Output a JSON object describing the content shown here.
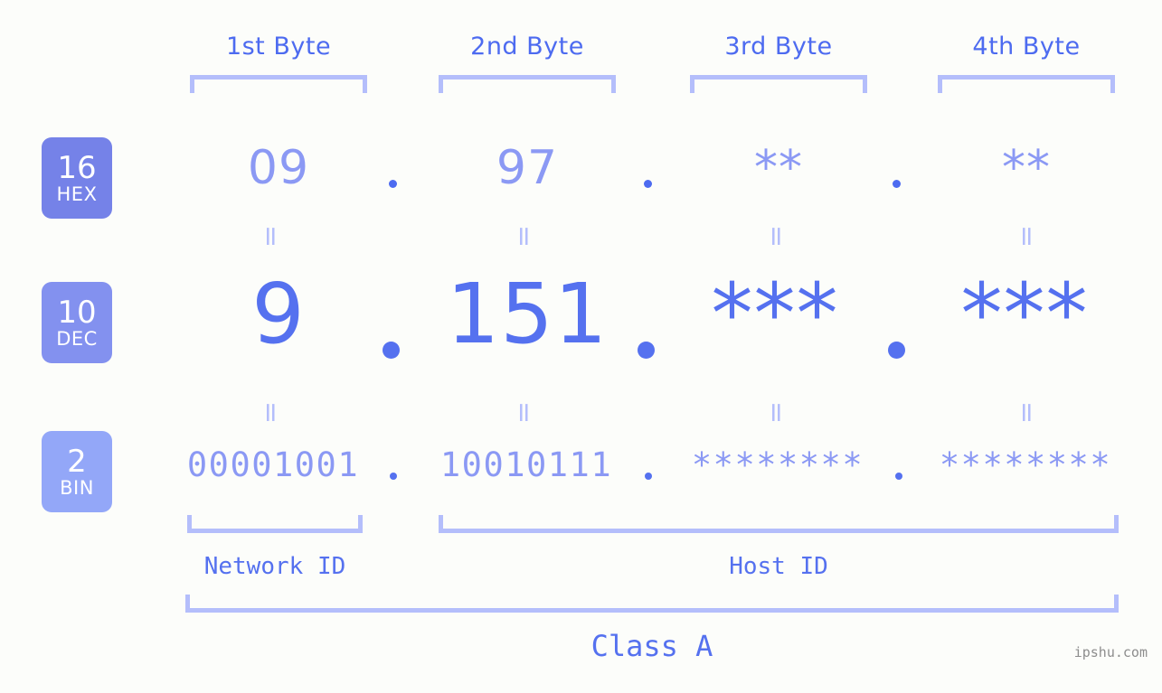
{
  "header": {
    "byte_labels": [
      "1st Byte",
      "2nd Byte",
      "3rd Byte",
      "4th Byte"
    ]
  },
  "rows": [
    {
      "base": "16",
      "name": "HEX",
      "values": [
        "09",
        "97",
        "**",
        "**"
      ],
      "separator": "."
    },
    {
      "base": "10",
      "name": "DEC",
      "values": [
        "9",
        "151",
        "***",
        "***"
      ],
      "separator": "."
    },
    {
      "base": "2",
      "name": "BIN",
      "values": [
        "00001001",
        "10010111",
        "********",
        "********"
      ],
      "separator": "."
    }
  ],
  "equals_glyph": "=",
  "footer": {
    "network_id_label": "Network ID",
    "host_id_label": "Host ID",
    "class_label": "Class A",
    "watermark": "ipshu.com"
  },
  "colors": {
    "background": "#fcfdfa",
    "accent_strong": "#4d6bf0",
    "accent_dec": "#5571ef",
    "accent_light": "#8b99f4",
    "bracket": "#b4befb",
    "badge_hex": "#7582e8",
    "badge_dec": "#8391ef",
    "badge_bin": "#93a7f8",
    "watermark": "#8d8d8d"
  }
}
